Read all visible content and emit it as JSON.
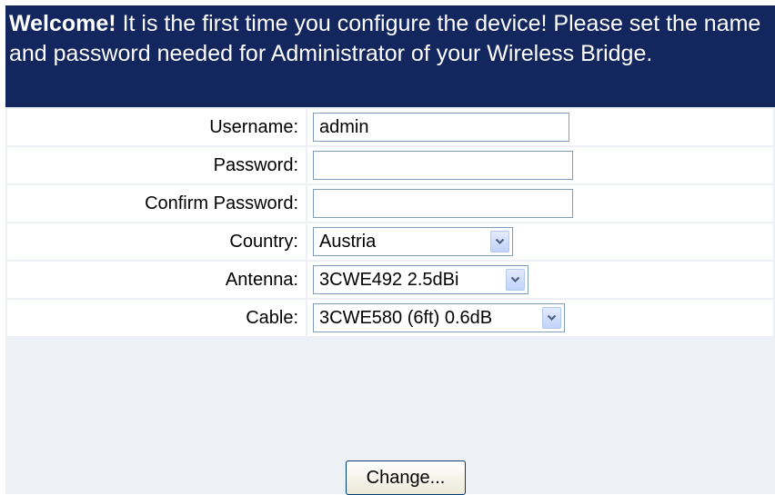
{
  "banner": {
    "bold": "Welcome!",
    "text": " It is the first time you configure the device! Please set the name and password needed for Administrator of your Wireless Bridge."
  },
  "form": {
    "username": {
      "label": "Username:",
      "value": "admin"
    },
    "password": {
      "label": "Password:",
      "value": ""
    },
    "confirm_password": {
      "label": "Confirm Password:",
      "value": ""
    },
    "country": {
      "label": "Country:",
      "selected": "Austria"
    },
    "antenna": {
      "label": "Antenna:",
      "selected": "3CWE492 2.5dBi"
    },
    "cable": {
      "label": "Cable:",
      "selected": "3CWE580 (6ft) 0.6dB"
    }
  },
  "actions": {
    "change_label": "Change..."
  },
  "icons": {
    "dropdown": "chevron-down-icon"
  },
  "colors": {
    "banner_bg": "#13265e",
    "page_bg": "#edf0f5",
    "input_border": "#7f9db9"
  }
}
